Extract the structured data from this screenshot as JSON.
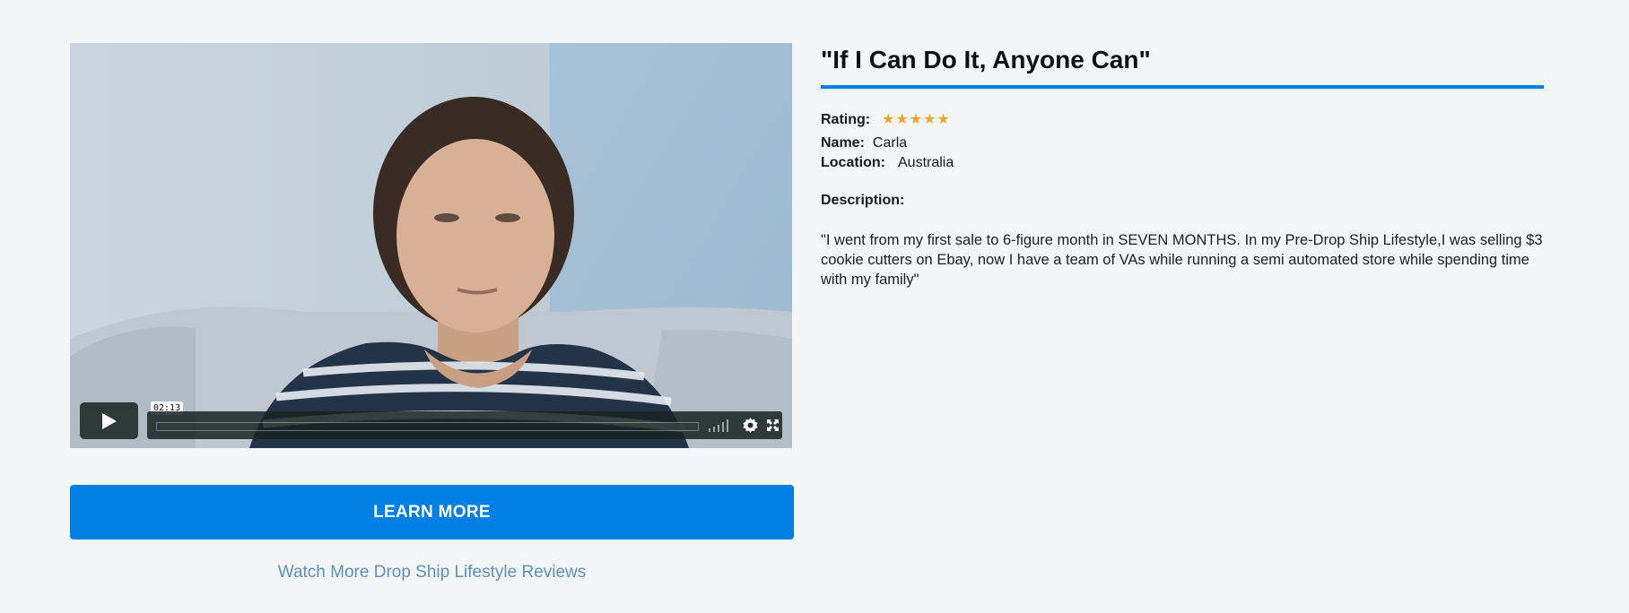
{
  "video": {
    "time": "02:13",
    "play_icon": "play-icon",
    "volume_icon": "volume-icon",
    "settings_icon": "gear-icon",
    "fullscreen_icon": "fullscreen-icon"
  },
  "cta": {
    "button_label": "LEARN MORE",
    "link_text": "Watch More Drop Ship Lifestyle Reviews"
  },
  "testimonial": {
    "title": "\"If I Can Do It, Anyone Can\"",
    "rating_label": "Rating:",
    "rating": 5,
    "name_label": "Name:",
    "name": "Carla",
    "location_label": "Location:",
    "location": "Australia",
    "description_label": "Description:",
    "description": "\"I went from my first sale to 6-figure month in SEVEN MONTHS. In my Pre-Drop Ship Lifestyle,I was selling $3 cookie cutters on Ebay, now I have a team of VAs while running a semi automated store while spending time with my family\""
  },
  "colors": {
    "accent": "#0080e5",
    "link": "#5b91be",
    "star": "#f0a52a",
    "background": "#f4f5f7"
  }
}
